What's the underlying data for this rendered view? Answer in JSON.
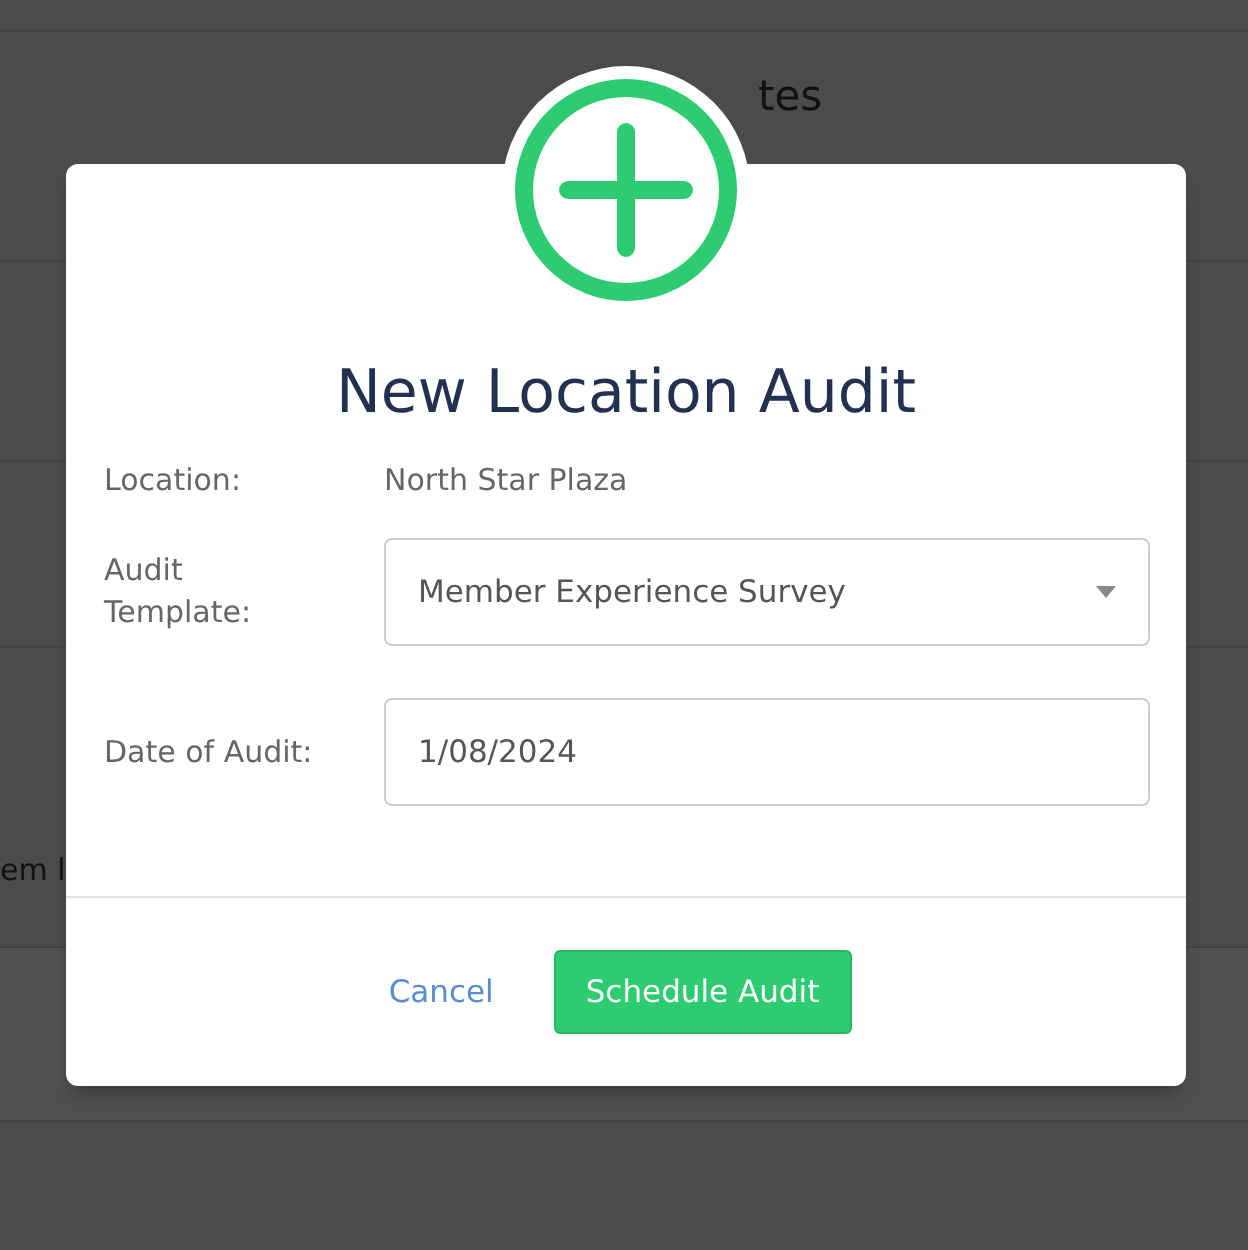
{
  "background": {
    "heading_fragment": "tes",
    "row_fragment": "em l"
  },
  "dialog": {
    "title": "New Location Audit",
    "fields": [
      {
        "kind": "static",
        "label": "Location:",
        "value": "North Star Plaza"
      },
      {
        "kind": "select",
        "label": "Audit Template:",
        "value": "Member Experience Survey"
      },
      {
        "kind": "input",
        "label": "Date of Audit:",
        "value": "1/08/2024"
      }
    ],
    "buttons": [
      {
        "kind": "link",
        "label": "Cancel"
      },
      {
        "kind": "primary",
        "label": "Schedule Audit"
      }
    ]
  }
}
